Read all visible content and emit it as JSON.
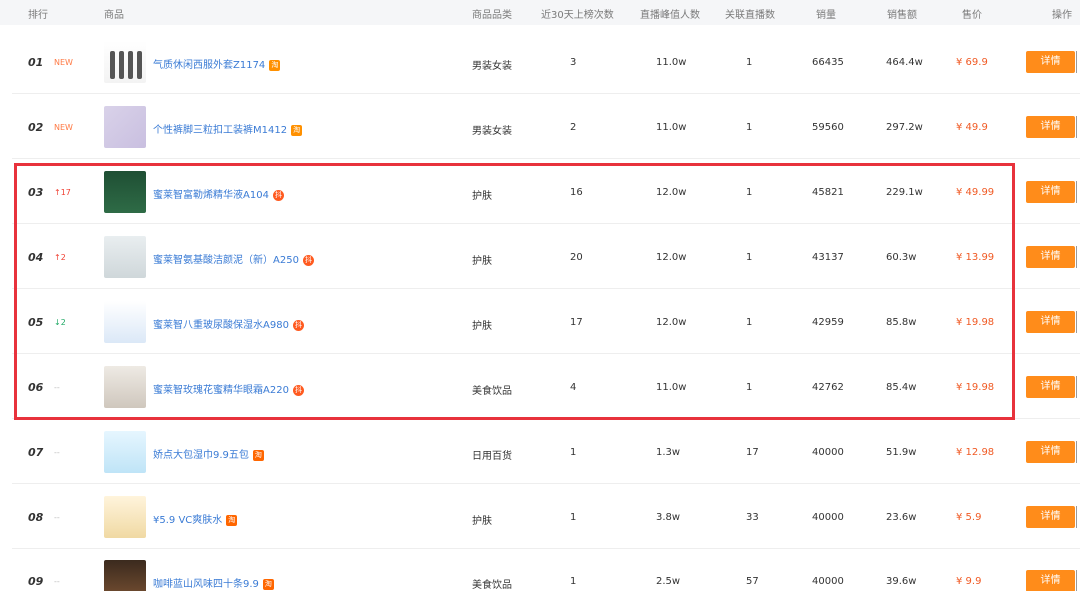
{
  "header": {
    "rank": "排行",
    "product": "商品",
    "category": "商品品类",
    "days_on_list": "近30天上榜次数",
    "peak_viewers": "直播峰值人数",
    "linked_streams": "关联直播数",
    "sales": "销量",
    "revenue": "销售额",
    "price": "售价",
    "action": "操作"
  },
  "rows": [
    {
      "rank": "01",
      "delta": "NEW",
      "delta_type": "new",
      "name": "气质休闲西服外套Z1174",
      "badge": "tb",
      "badge_text": "淘",
      "category": "男装女装",
      "days": "3",
      "peak": "11.0w",
      "live": "1",
      "sales": "66435",
      "revenue": "464.4w",
      "price": "¥ 69.9",
      "btn": "详情"
    },
    {
      "rank": "02",
      "delta": "NEW",
      "delta_type": "new",
      "name": "个性裤脚三粒扣工装裤M1412",
      "badge": "tb",
      "badge_text": "淘",
      "category": "男装女装",
      "days": "2",
      "peak": "11.0w",
      "live": "1",
      "sales": "59560",
      "revenue": "297.2w",
      "price": "¥ 49.9",
      "btn": "详情"
    },
    {
      "rank": "03",
      "delta": "↑17",
      "delta_type": "up",
      "name": "蜜莱智富勒烯精华液A104",
      "badge": "dy",
      "badge_text": "抖",
      "category": "护肤",
      "days": "16",
      "peak": "12.0w",
      "live": "1",
      "sales": "45821",
      "revenue": "229.1w",
      "price": "¥ 49.99",
      "btn": "详情"
    },
    {
      "rank": "04",
      "delta": "↑2",
      "delta_type": "up",
      "name": "蜜莱智氨基酸洁颜泥（新）A250",
      "badge": "dy",
      "badge_text": "抖",
      "category": "护肤",
      "days": "20",
      "peak": "12.0w",
      "live": "1",
      "sales": "43137",
      "revenue": "60.3w",
      "price": "¥ 13.99",
      "btn": "详情"
    },
    {
      "rank": "05",
      "delta": "↓2",
      "delta_type": "down",
      "name": "蜜莱智八重玻尿酸保湿水A980",
      "badge": "dy",
      "badge_text": "抖",
      "category": "护肤",
      "days": "17",
      "peak": "12.0w",
      "live": "1",
      "sales": "42959",
      "revenue": "85.8w",
      "price": "¥ 19.98",
      "btn": "详情"
    },
    {
      "rank": "06",
      "delta": "--",
      "delta_type": "flat",
      "name": "蜜莱智玫瑰花蜜精华眼霜A220",
      "badge": "dy",
      "badge_text": "抖",
      "category": "美食饮品",
      "days": "4",
      "peak": "11.0w",
      "live": "1",
      "sales": "42762",
      "revenue": "85.4w",
      "price": "¥ 19.98",
      "btn": "详情"
    },
    {
      "rank": "07",
      "delta": "--",
      "delta_type": "flat",
      "name": "娇点大包湿巾9.9五包",
      "badge": "tm",
      "badge_text": "淘",
      "category": "日用百货",
      "days": "1",
      "peak": "1.3w",
      "live": "17",
      "sales": "40000",
      "revenue": "51.9w",
      "price": "¥ 12.98",
      "btn": "详情"
    },
    {
      "rank": "08",
      "delta": "--",
      "delta_type": "flat",
      "name": "¥5.9 VC爽肤水",
      "badge": "tm",
      "badge_text": "淘",
      "category": "护肤",
      "days": "1",
      "peak": "3.8w",
      "live": "33",
      "sales": "40000",
      "revenue": "23.6w",
      "price": "¥ 5.9",
      "btn": "详情"
    },
    {
      "rank": "09",
      "delta": "--",
      "delta_type": "flat",
      "name": "咖啡蓝山风味四十条9.9",
      "badge": "tm",
      "badge_text": "淘",
      "category": "美食饮品",
      "days": "1",
      "peak": "2.5w",
      "live": "57",
      "sales": "40000",
      "revenue": "39.6w",
      "price": "¥ 9.9",
      "btn": "详情"
    }
  ],
  "colors": {
    "accent_button": "#ff8c1a",
    "price": "#f05a24",
    "link": "#3a7bd5",
    "highlight_box": "#e8323c"
  }
}
